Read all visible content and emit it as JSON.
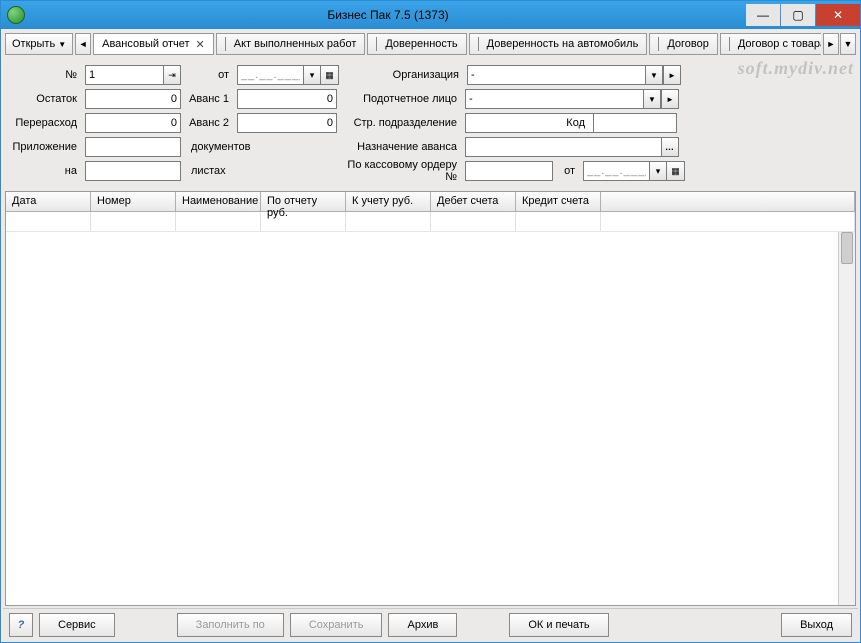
{
  "titlebar": {
    "title": "Бизнес Пак 7.5 (1373)"
  },
  "watermark": "soft.mydiv.net",
  "toolbar": {
    "open_label": "Открыть",
    "tabs": [
      "Авансовый отчет",
      "Акт выполненных работ",
      "Доверенность",
      "Доверенность на автомобиль",
      "Договор",
      "Договор с товарами"
    ]
  },
  "form": {
    "labels": {
      "number": "№",
      "date_from": "от",
      "org": "Организация",
      "balance": "Остаток",
      "advance1": "Аванс 1",
      "account_person": "Подотчетное лицо",
      "overexp": "Перерасход",
      "advance2": "Аванс 2",
      "struct_dept": "Стр. подразделение",
      "code": "Код",
      "attachment": "Приложение",
      "docs": "документов",
      "advance_purpose": "Назначение аванса",
      "on": "на",
      "sheets": "листах",
      "cash_order": "По кассовому ордеру №",
      "date_from2": "от"
    },
    "values": {
      "number": "1",
      "date1": "__.__.____",
      "org": "-",
      "balance": "0",
      "advance1": "0",
      "person": "-",
      "overexp": "0",
      "advance2": "0",
      "struct_dept": "",
      "code": "",
      "attachment": "",
      "purpose": "",
      "on": "",
      "cash_order": "",
      "date2": "__.__.____"
    }
  },
  "grid": {
    "columns": [
      "Дата",
      "Номер",
      "Наименование",
      "По отчету руб.",
      "К учету руб.",
      "Дебет счета",
      "Кредит счета"
    ]
  },
  "footer": {
    "help": "?",
    "service": "Сервис",
    "fill": "Заполнить по",
    "save": "Сохранить",
    "archive": "Архив",
    "print": "ОК и печать",
    "exit": "Выход"
  }
}
